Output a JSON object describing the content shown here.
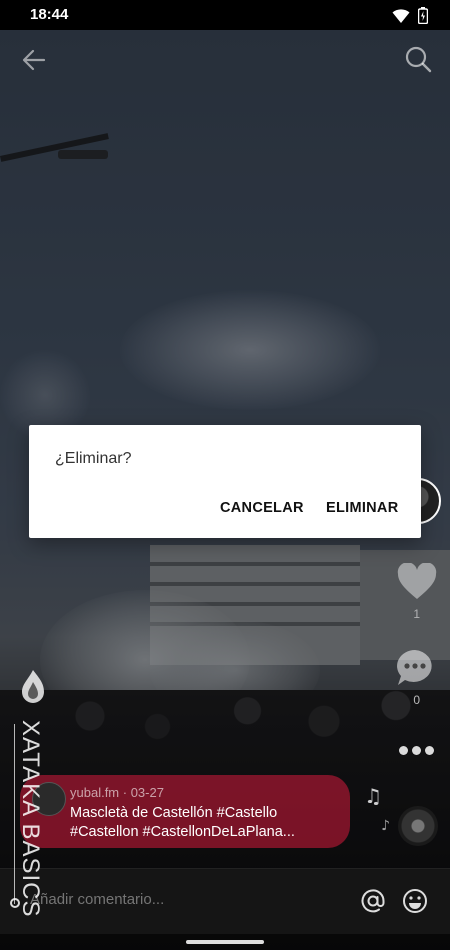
{
  "status_bar": {
    "time": "18:44"
  },
  "dialog": {
    "title": "¿Eliminar?",
    "cancel_label": "CANCELAR",
    "delete_label": "ELIMINAR"
  },
  "post": {
    "username": "yubal.fm",
    "date": "03-27",
    "caption_line1": "Mascletà de Castellón #Castello",
    "caption_line2": "#Castellon #CastellonDeLaPlana...",
    "like_count": "1",
    "comment_count": "0"
  },
  "watermark": {
    "text": "XATAKA BASICS"
  },
  "comment_bar": {
    "placeholder": "Añadir comentario..."
  },
  "colors": {
    "caption_card": "#be1937",
    "dialog_bg": "#ffffff"
  },
  "icons": [
    "back-arrow-icon",
    "search-icon",
    "heart-icon",
    "comment-icon",
    "more-icon",
    "music-note-icon",
    "at-icon",
    "emoji-icon",
    "wifi-icon",
    "battery-icon"
  ]
}
